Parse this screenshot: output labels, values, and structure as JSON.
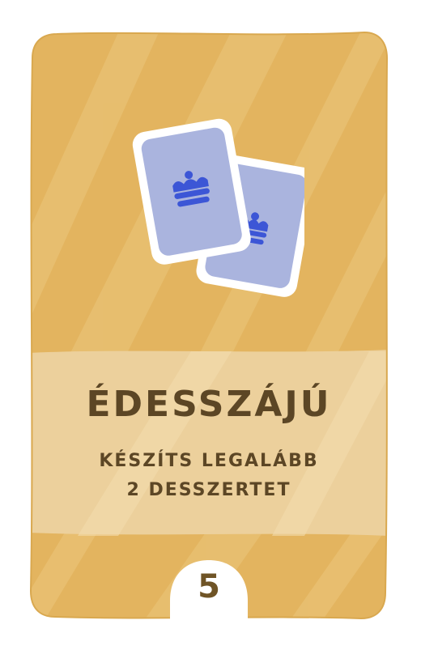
{
  "card": {
    "title": "ÉDESSZÁJÚ",
    "objective_line1": "KÉSZÍTS LEGALÁBB",
    "objective_line2": "2 DESSZERTET",
    "points": "5",
    "icon": "two-cards-with-dessert-icon",
    "colors": {
      "card_gold": "#e3b45f",
      "band": "#ecd09c",
      "text_brown": "#5c4625",
      "card_art_fill": "#aab4de",
      "card_art_icon": "#3c56d6"
    }
  }
}
